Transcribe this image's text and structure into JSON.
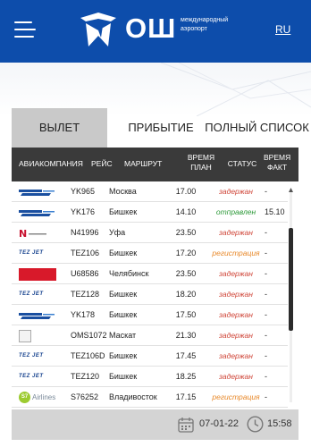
{
  "header": {
    "logo_text": "ОШ",
    "logo_sub_line1": "международный",
    "logo_sub_line2": "аэропорт",
    "lang": "RU",
    "brand_color": "#0d4dab"
  },
  "tabs": [
    {
      "label": "ВЫЛЕТ",
      "active": true
    },
    {
      "label": "ПРИБЫТИЕ",
      "active": false
    },
    {
      "label": "ПОЛНЫЙ СПИСОК",
      "active": false
    }
  ],
  "table": {
    "headers": {
      "airline": "АВИАКОМПАНИЯ",
      "flight": "РЕЙС",
      "route": "МАРШРУТ",
      "plan_1": "ВРЕМЯ",
      "plan_2": "ПЛАН",
      "status": "СТАТУС",
      "fact_1": "ВРЕМЯ",
      "fact_2": "ФАКТ"
    },
    "rows": [
      {
        "logo": "avia-traffic-logo",
        "flight": "YK965",
        "route": "Москва",
        "plan": "17.00",
        "status": "задержан",
        "status_type": "delay",
        "fact": "-"
      },
      {
        "logo": "avia-traffic-logo",
        "flight": "YK176",
        "route": "Бишкек",
        "plan": "14.10",
        "status": "отправлен",
        "status_type": "sent",
        "fact": "15.10"
      },
      {
        "logo": "nordwind-logo",
        "flight": "N41996",
        "route": "Уфа",
        "plan": "23.50",
        "status": "задержан",
        "status_type": "delay",
        "fact": "-"
      },
      {
        "logo": "tez-jet-logo",
        "flight": "TEZ106",
        "route": "Бишкек",
        "plan": "17.20",
        "status": "регистрация",
        "status_type": "reg",
        "fact": "-"
      },
      {
        "logo": "ural-airlines-logo",
        "flight": "U68586",
        "route": "Челябинск",
        "plan": "23.50",
        "status": "задержан",
        "status_type": "delay",
        "fact": "-"
      },
      {
        "logo": "tez-jet-logo",
        "flight": "TEZ128",
        "route": "Бишкек",
        "plan": "18.20",
        "status": "задержан",
        "status_type": "delay",
        "fact": "-"
      },
      {
        "logo": "avia-traffic-logo",
        "flight": "YK178",
        "route": "Бишкек",
        "plan": "17.50",
        "status": "задержан",
        "status_type": "delay",
        "fact": "-"
      },
      {
        "logo": "broken-image-logo",
        "flight": "OMS1072",
        "route": "Маскат",
        "plan": "21.30",
        "status": "задержан",
        "status_type": "delay",
        "fact": "-"
      },
      {
        "logo": "tez-jet-logo",
        "flight": "TEZ106D",
        "route": "Бишкек",
        "plan": "17.45",
        "status": "задержан",
        "status_type": "delay",
        "fact": "-"
      },
      {
        "logo": "tez-jet-logo",
        "flight": "TEZ120",
        "route": "Бишкек",
        "plan": "18.25",
        "status": "задержан",
        "status_type": "delay",
        "fact": "-"
      },
      {
        "logo": "s7-airlines-logo",
        "flight": "S76252",
        "route": "Владивосток",
        "plan": "17.15",
        "status": "регистрация",
        "status_type": "reg",
        "fact": "-"
      }
    ]
  },
  "logo_texts": {
    "s7": "Airlines",
    "s7_mark": "S7",
    "tez": "TEZ JET"
  },
  "footer": {
    "date": "07-01-22",
    "time": "15:58"
  },
  "status_colors": {
    "delay": "#d0473a",
    "sent": "#2e9a3a",
    "reg": "#e8892a"
  }
}
